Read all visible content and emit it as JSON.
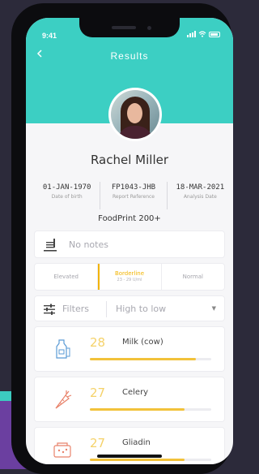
{
  "status_bar": {
    "time": "9:41"
  },
  "header": {
    "title": "Results",
    "back_icon": "chevron-left-icon"
  },
  "profile": {
    "name": "Rachel Miller"
  },
  "info": [
    {
      "value": "01-JAN-1970",
      "label": "Date of birth"
    },
    {
      "value": "FP1043-JHB",
      "label": "Report Reference"
    },
    {
      "value": "18-MAR-2021",
      "label": "Analysis Date"
    }
  ],
  "product": "FoodPrint 200+",
  "notes": {
    "placeholder": "No notes",
    "icon": "notes-icon"
  },
  "levels": [
    {
      "label": "Elevated",
      "sub": ""
    },
    {
      "label": "Borderline",
      "sub": "23 - 29 U/ml"
    },
    {
      "label": "Normal",
      "sub": ""
    }
  ],
  "levels_selected": "Borderline",
  "filters": {
    "label": "Filters",
    "sort": "High to low",
    "icon": "sliders-icon"
  },
  "items": [
    {
      "score": "28",
      "name": "Milk (cow)",
      "icon": "milk-bottle-icon",
      "level": 0.87
    },
    {
      "score": "27",
      "name": "Celery",
      "icon": "carrot-icon",
      "level": 0.78
    },
    {
      "score": "27",
      "name": "Gliadin",
      "icon": "grain-icon",
      "level": 0.78
    }
  ],
  "colors": {
    "header": "#3ccfc3",
    "accent": "#f2b400",
    "score": "#f5d26a",
    "item_icon_milk": "#5b9bd5",
    "item_icon_celery": "#e8826a",
    "item_icon_gliadin": "#e8826a"
  }
}
